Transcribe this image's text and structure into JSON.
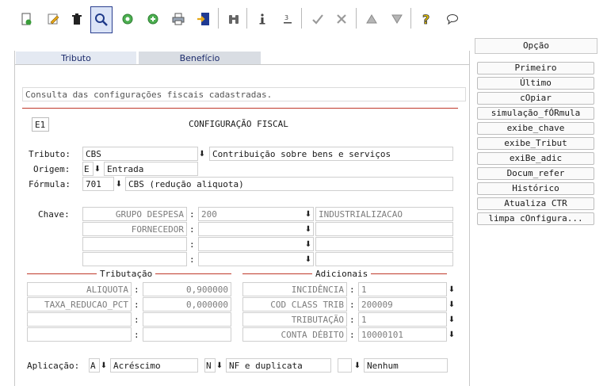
{
  "toolbar": {
    "icons": [
      "new-document-icon",
      "edit-pencil-icon",
      "delete-trash-icon",
      "search-magnifier-icon",
      "record-circle-icon",
      "add-circle-icon",
      "print-icon",
      "export-door-icon",
      "binoculars-icon",
      "info-icon",
      "sort-icon",
      "confirm-check-icon",
      "cancel-tools-icon",
      "up-triangle-icon",
      "down-triangle-icon",
      "help-question-icon",
      "chat-bubble-icon"
    ]
  },
  "tabs": {
    "tributo": "Tributo",
    "beneficio": "Benefício"
  },
  "description": "Consulta das configurações fiscais cadastradas.",
  "header": {
    "code": "E1",
    "title": "CONFIGURAÇÃO FISCAL"
  },
  "form": {
    "tributo_label": "Tributo:",
    "tributo_code": "CBS",
    "tributo_desc": "Contribuição sobre bens e serviços",
    "origem_label": "Origem:",
    "origem_code": "E",
    "origem_desc": "Entrada",
    "formula_label": "Fórmula:",
    "formula_code": "701",
    "formula_desc": "CBS (redução aliquota)"
  },
  "chave": {
    "label": "Chave:",
    "rows": [
      {
        "key": "GRUPO DESPESA",
        "value": "200",
        "desc": "INDUSTRIALIZACAO"
      },
      {
        "key": "FORNECEDOR",
        "value": "",
        "desc": ""
      },
      {
        "key": "",
        "value": "",
        "desc": ""
      },
      {
        "key": "",
        "value": "",
        "desc": ""
      }
    ]
  },
  "tributacao": {
    "title": "Tributação",
    "rows": [
      {
        "key": "ALIQUOTA",
        "value": "0,900000"
      },
      {
        "key": "TAXA_REDUCAO_PCT",
        "value": "0,000000"
      },
      {
        "key": "",
        "value": ""
      },
      {
        "key": "",
        "value": ""
      }
    ]
  },
  "adicionais": {
    "title": "Adicionais",
    "rows": [
      {
        "key": "INCIDÊNCIA",
        "value": "1"
      },
      {
        "key": "COD CLASS TRIB",
        "value": "200009"
      },
      {
        "key": "TRIBUTAÇÃO",
        "value": "1"
      },
      {
        "key": "CONTA DÉBITO",
        "value": "10000101"
      }
    ]
  },
  "aplicacao": {
    "label": "Aplicação:",
    "code1": "A",
    "desc1": "Acréscimo",
    "code2": "N",
    "desc2": "NF e duplicata",
    "code3": "",
    "desc3": "Nenhum"
  },
  "side": {
    "title": "Opção",
    "buttons": [
      "Primeiro",
      "Último",
      "cOpiar",
      "simulação_fÓRmula",
      "exibe_chave",
      "exibe_Tribut",
      "exiBe_adic",
      "Docum_refer",
      "Histórico",
      "Atualiza CTR",
      "limpa cOnfigura..."
    ]
  },
  "colors": {
    "accent_line": "#c0392b",
    "tab_bg": "#e4e9f2",
    "selected_border": "#2a3f8f"
  }
}
